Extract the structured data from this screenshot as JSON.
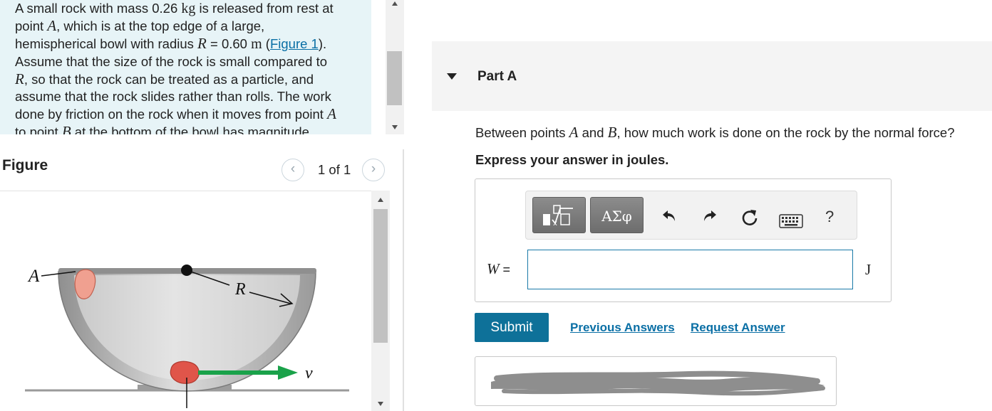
{
  "problem": {
    "line1_a": "A small rock with mass 0.26 ",
    "unit_kg": "kg",
    "line1_b": " is released from rest at",
    "line2_a": "point ",
    "point_a": "A",
    "line2_b": ", which is at the top edge of a large,",
    "line3_a": "hemispherical bowl with radius ",
    "var_r": "R",
    "line3_b": " = 0.60 ",
    "unit_m": "m",
    "line3_c": " (",
    "figure_link": "Figure 1",
    "line3_d": ").",
    "line4": "Assume that the size of the rock is small compared to",
    "line5_b": ", so that the rock can be treated as a particle, and",
    "line6": "assume that the rock slides rather than rolls. The work",
    "line7_a": "done by friction on the rock when it moves from point ",
    "line8_a": "to point ",
    "point_b": "B",
    "line8_b": " at the bottom of the bowl has magnitude"
  },
  "figure": {
    "title": "Figure",
    "pager": "1 of 1",
    "prev_icon": "‹",
    "next_icon": "›",
    "label_a": "A",
    "label_r": "R",
    "label_v": "v",
    "colors": {
      "bowl": "#b3b3b3",
      "rim": "#8a8a8a",
      "rock_top": "#f0a090",
      "rock_bottom": "#e0554a",
      "arrow": "#1aa24a"
    }
  },
  "part": {
    "title": "Part A",
    "question_a": "Between points ",
    "point_a": "A",
    "question_b": " and ",
    "point_b": "B",
    "question_c": ", how much work is done on the rock by the normal force?",
    "instruction": "Express your answer in joules."
  },
  "toolbar": {
    "greek_label": "ΑΣφ",
    "help_label": "?",
    "icons": [
      "templates-icon",
      "greek-symbols-icon",
      "undo-icon",
      "redo-icon",
      "reset-icon",
      "keyboard-icon",
      "help-icon"
    ]
  },
  "answer": {
    "variable": "W",
    "equals": " =",
    "value": "",
    "unit": "J"
  },
  "actions": {
    "submit_label": "Submit",
    "previous_answers": "Previous Answers",
    "request_answer": "Request Answer"
  },
  "colors": {
    "accent": "#0e7199",
    "link": "#0a6fa5",
    "panel_bg": "#e7f4f7"
  }
}
